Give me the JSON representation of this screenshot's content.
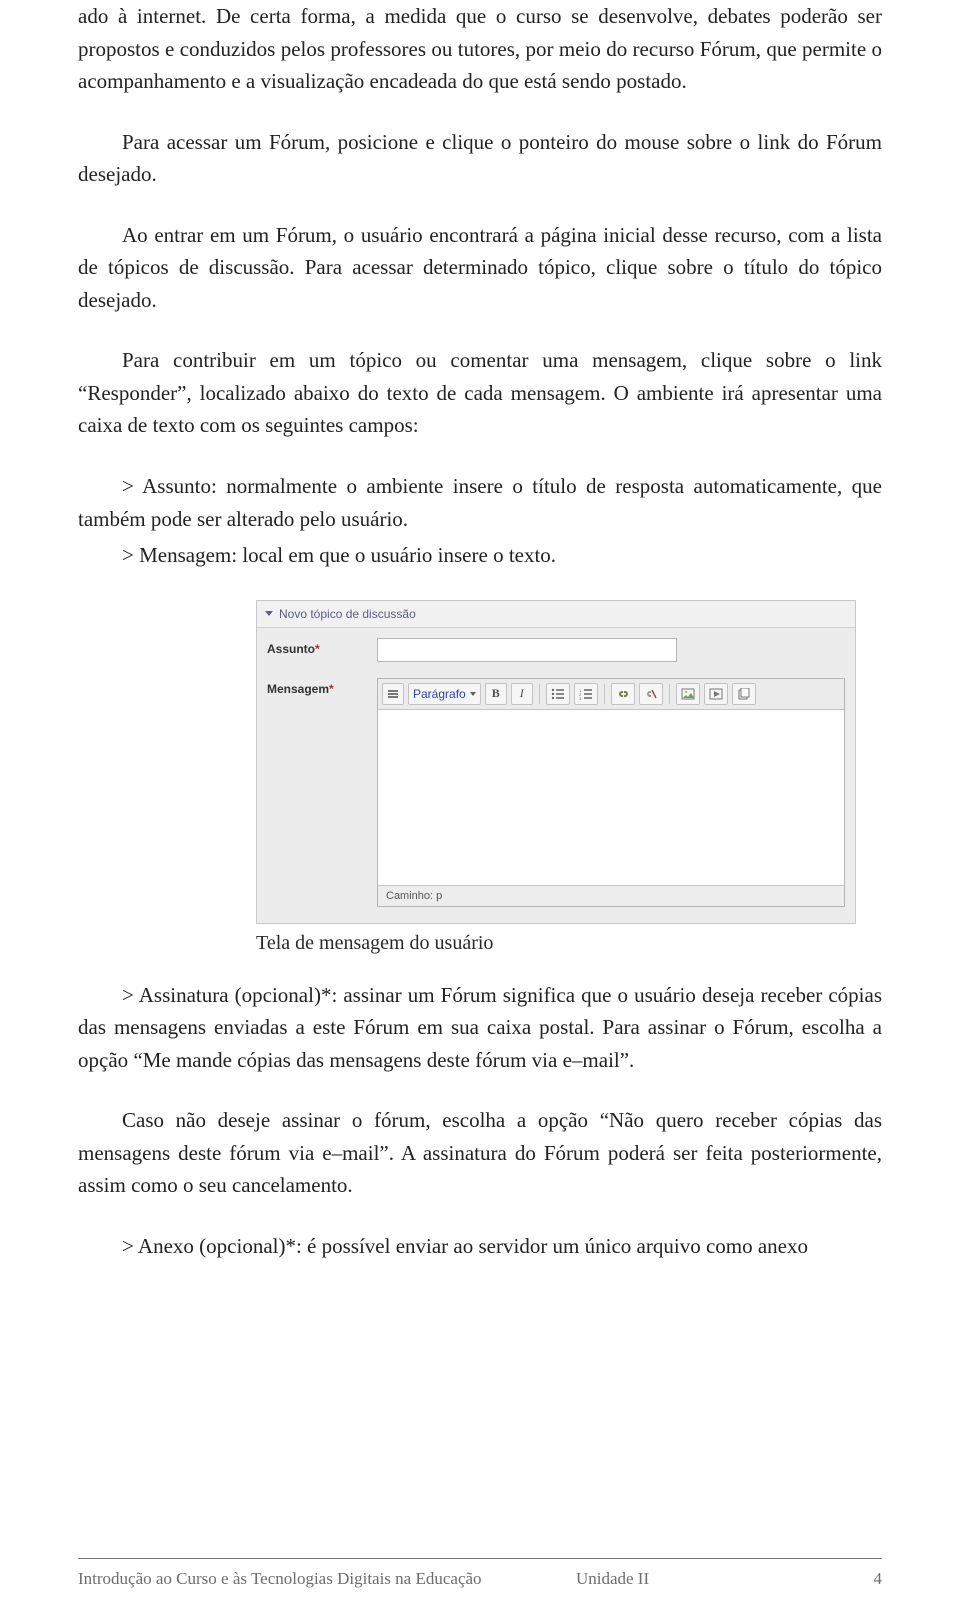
{
  "paragraphs": {
    "p1": "ado à internet. De certa forma, a medida que o curso se desenvolve, debates poderão ser propostos e conduzidos pelos professores ou tutores, por meio do recurso Fórum, que permite o acompanhamento e a visualização encadeada do que está sendo postado.",
    "p2": "Para acessar um Fórum, posicione e clique o ponteiro do mouse sobre o link do Fórum desejado.",
    "p3": "Ao entrar em um Fórum, o usuário encontrará a página inicial desse recurso, com a lista de tópicos de discussão. Para acessar determinado tópico, clique sobre o título do tópico desejado.",
    "p4": "Para contribuir em um tópico ou comentar uma mensagem, clique sobre o link “Responder”, localizado abaixo do texto de cada mensagem. O ambiente irá apresentar uma caixa de texto com os seguintes campos:",
    "p5": "> Assunto: normalmente o ambiente insere o título de resposta automaticamente, que também pode ser alterado pelo usuário.",
    "p6": "> Mensagem: local em que o usuário insere o texto.",
    "p7": "> Assinatura (opcional)*: assinar um Fórum significa que o usuário deseja receber cópias das mensagens enviadas a este Fórum em sua caixa postal. Para assinar o Fórum, escolha a opção “Me mande cópias das mensagens deste fórum via e–mail”.",
    "p8": "Caso não deseje assinar o fórum, escolha a opção “Não quero receber cópias das mensagens deste fórum via e–mail”. A assinatura do Fórum poderá ser feita posteriormente, assim como o seu cancelamento.",
    "p9": "> Anexo (opcional)*: é possível enviar ao servidor um único arquivo como anexo"
  },
  "editor": {
    "panel_title": "Novo tópico de discussão",
    "subject_label": "Assunto",
    "message_label": "Mensagem",
    "required_mark": "*",
    "toolbar": {
      "format": "Parágrafo",
      "bold": "B",
      "italic": "I"
    },
    "status_prefix": "Caminho:",
    "status_value": "p",
    "caption": "Tela de mensagem do usuário"
  },
  "footer": {
    "left": "Introdução ao Curso e às Tecnologias Digitais na Educação",
    "center": "Unidade II",
    "page": "4"
  }
}
